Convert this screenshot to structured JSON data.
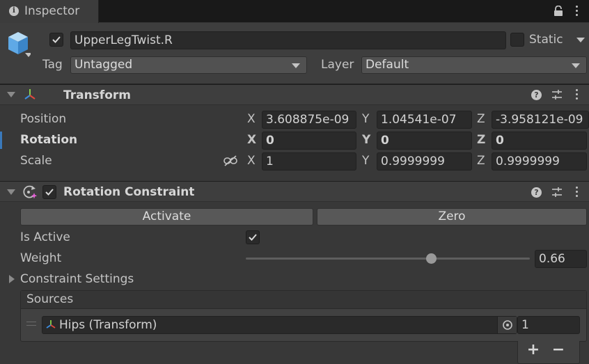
{
  "tab": {
    "title": "Inspector"
  },
  "header": {
    "object_name": "UpperLegTwist.R",
    "active": true,
    "static_label": "Static",
    "static": false,
    "tag_label": "Tag",
    "tag_value": "Untagged",
    "layer_label": "Layer",
    "layer_value": "Default"
  },
  "transform": {
    "title": "Transform",
    "rows": [
      {
        "label": "Position",
        "x": "3.608875e-09",
        "y": "1.04541e-07",
        "z": "-3.958121e-09"
      },
      {
        "label": "Rotation",
        "x": "0",
        "y": "0",
        "z": "0"
      },
      {
        "label": "Scale",
        "x": "1",
        "y": "0.9999999",
        "z": "0.9999999"
      }
    ],
    "axis_x": "X",
    "axis_y": "Y",
    "axis_z": "Z"
  },
  "rotation_constraint": {
    "title": "Rotation Constraint",
    "enabled": true,
    "activate_label": "Activate",
    "zero_label": "Zero",
    "is_active_label": "Is Active",
    "is_active": true,
    "weight_label": "Weight",
    "weight_value": "0.66",
    "weight_fraction": 0.66,
    "settings_label": "Constraint Settings",
    "sources_label": "Sources",
    "sources": [
      {
        "name": "Hips (Transform)",
        "weight": "1"
      }
    ],
    "add_label": "+",
    "remove_label": "−"
  },
  "colors": {
    "background": "#383838",
    "field": "#2a2a2a",
    "accent": "#3a79bb"
  }
}
